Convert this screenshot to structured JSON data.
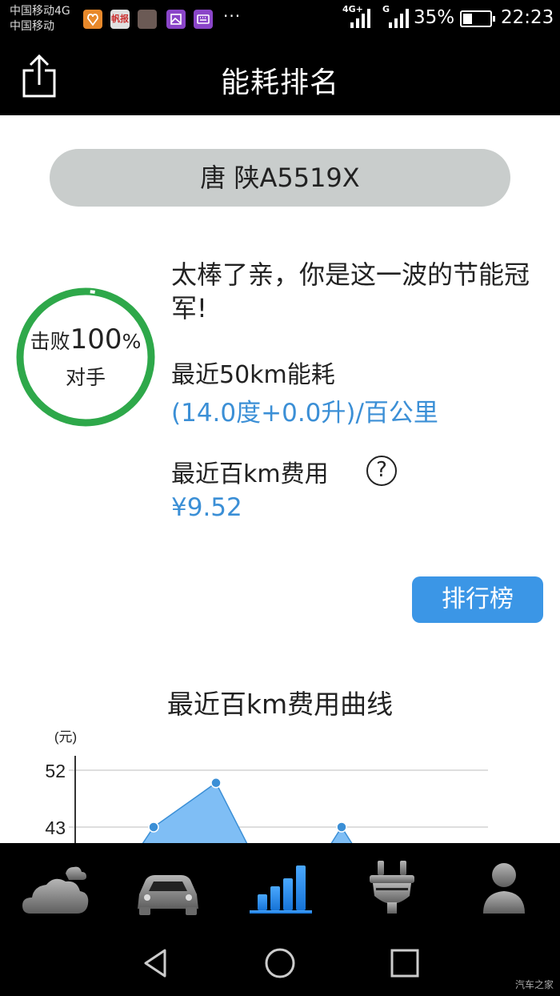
{
  "status_bar": {
    "carrier_1": "中国移动4G",
    "carrier_2": "中国移动",
    "notif_app_label": "帆报",
    "more_icons": "···",
    "net_1": "4G+",
    "net_2": "G",
    "battery_pct": "35%",
    "battery_level": 0.35,
    "time": "22:23"
  },
  "header": {
    "title": "能耗排名",
    "share_icon": "share-icon"
  },
  "plate": "唐 陕A5519X",
  "gauge": {
    "prefix": "击败",
    "percent": "100",
    "percent_sign": "%",
    "suffix": "对手",
    "ring_color": "#2ea84a"
  },
  "message": "太棒了亲，你是这一波的节能冠军!",
  "energy": {
    "label": "最近50km能耗",
    "value": "(14.0度+0.0升)/百公里"
  },
  "cost": {
    "label": "最近百km费用",
    "help": "?",
    "value": "¥9.52"
  },
  "rank_button": "排行榜",
  "chart_data": {
    "type": "area",
    "title": "最近百km费用曲线",
    "ylabel": "(元)",
    "ytick_labels": [
      "52",
      "43"
    ],
    "ylim": [
      34,
      52
    ],
    "x": [
      1,
      2,
      3,
      4,
      5
    ],
    "values": [
      null,
      43,
      50,
      null,
      43
    ],
    "grid": true,
    "color": "#3b8fd6",
    "fill": "#7fbef5"
  },
  "tabs": [
    {
      "name": "weather-cloud-icon"
    },
    {
      "name": "car-icon"
    },
    {
      "name": "ranking-bars-icon",
      "active": true
    },
    {
      "name": "charging-plug-icon"
    },
    {
      "name": "user-profile-icon"
    }
  ],
  "watermark": "汽车之家",
  "colors": {
    "accent": "#3b8fd6",
    "button": "#3b96e6",
    "active_tab": "#2d8ff0",
    "inactive_tab": "#8a8a8a"
  }
}
